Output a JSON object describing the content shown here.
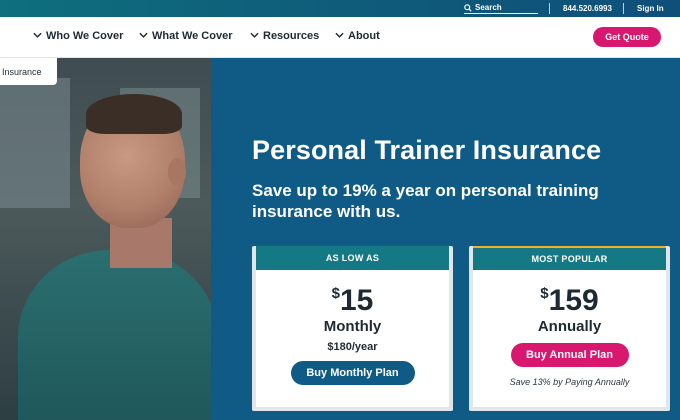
{
  "utility": {
    "search_label": "Search",
    "phone": "844.520.6993",
    "signin": "Sign In"
  },
  "nav": {
    "items": [
      {
        "label": "Who We Cover"
      },
      {
        "label": "What We Cover"
      },
      {
        "label": "Resources"
      },
      {
        "label": "About"
      }
    ],
    "cta": "Get Quote"
  },
  "hero": {
    "photo_label": "Insurance",
    "title": "Personal Trainer Insurance",
    "subtitle": "Save up to 19% a year on personal training insurance with us."
  },
  "plans": [
    {
      "badge": "AS LOW AS",
      "currency": "$",
      "amount": "15",
      "period": "Monthly",
      "yearly": "$180/year",
      "button": "Buy Monthly Plan"
    },
    {
      "badge": "MOST POPULAR",
      "currency": "$",
      "amount": "159",
      "period": "Annually",
      "button": "Buy Annual Plan",
      "note": "Save 13% by Paying Annually"
    }
  ],
  "colors": {
    "brand_pink": "#d8186e",
    "brand_blue": "#0f5b86",
    "teal": "#157985",
    "accent_gold": "#f2b227"
  }
}
